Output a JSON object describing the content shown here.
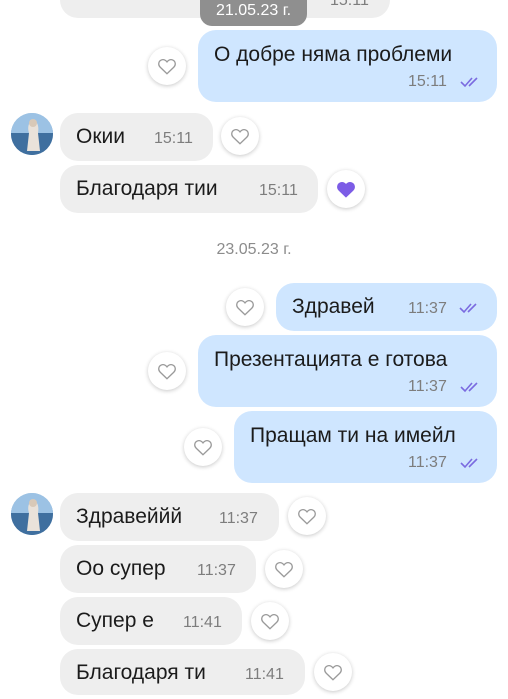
{
  "top": {
    "date_chip": "21.05.23 г.",
    "partial_time": "15:11"
  },
  "date_separator": "23.05.23 г.",
  "messages": [
    {
      "text": "О добре няма проблеми",
      "time": "15:11"
    },
    {
      "text": "Окии",
      "time": "15:11"
    },
    {
      "text": "Благодаря тии",
      "time": "15:11"
    },
    {
      "text": "Здравей",
      "time": "11:37"
    },
    {
      "text": "Презентацията е готова",
      "time": "11:37"
    },
    {
      "text": "Пращам ти на имейл",
      "time": "11:37"
    },
    {
      "text": "Здравеййй",
      "time": "11:37"
    },
    {
      "text": "Оо супер",
      "time": "11:37"
    },
    {
      "text": "Супер е",
      "time": "11:41"
    },
    {
      "text": "Благодаря ти",
      "time": "11:41"
    }
  ],
  "colors": {
    "outgoing_bubble": "#cfe6ff",
    "incoming_bubble": "#eeeeee",
    "read_ticks": "#7b6be0",
    "liked_heart": "#7c5ce6"
  },
  "icons": {
    "like": "heart-outline-icon",
    "liked": "heart-filled-icon",
    "read": "double-check-icon"
  }
}
